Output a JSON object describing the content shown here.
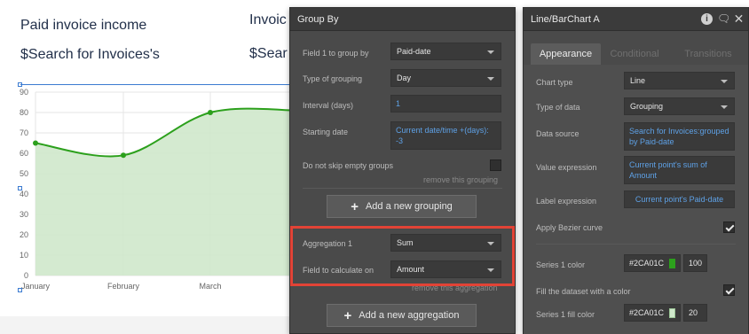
{
  "canvas": {
    "title_left": "Paid invoice income",
    "subtitle_left": "$Search for Invoices's",
    "title_right_partial": "Invoic",
    "subtitle_right_partial": "$Sear"
  },
  "chart_data": {
    "type": "area",
    "x": [
      "January",
      "February",
      "March"
    ],
    "series": [
      {
        "values": [
          65,
          59,
          80,
          81
        ]
      }
    ],
    "x_positions_labels": [
      "January",
      "February",
      "March"
    ],
    "ylim": [
      0,
      90
    ],
    "y_ticks": [
      "90",
      "80",
      "70",
      "60",
      "50",
      "40",
      "30",
      "20",
      "10",
      "0"
    ],
    "line_color": "#2CA01C",
    "fill_color": "#cfe8cb",
    "grid": true,
    "bezier": true
  },
  "group_by": {
    "title": "Group By",
    "field1_label": "Field 1 to group by",
    "field1_value": "Paid-date",
    "type_label": "Type of grouping",
    "type_value": "Day",
    "interval_label": "Interval (days)",
    "interval_value": "1",
    "start_label": "Starting date",
    "start_value": "Current date/time +(days): -3",
    "skip_label": "Do not skip empty groups",
    "remove_grouping": "remove this grouping",
    "add_grouping": "Add a new grouping",
    "agg_label": "Aggregation 1",
    "agg_value": "Sum",
    "calc_label": "Field to calculate on",
    "calc_value": "Amount",
    "remove_agg": "remove this aggregation",
    "add_agg": "Add a new aggregation"
  },
  "chart_panel": {
    "title": "Line/BarChart A",
    "tabs": [
      "Appearance",
      "Conditional",
      "Transitions"
    ],
    "chart_type_label": "Chart type",
    "chart_type_value": "Line",
    "data_type_label": "Type of data",
    "data_type_value": "Grouping",
    "source_label": "Data source",
    "source_value": "Search for Invoices:grouped by Paid-date",
    "value_label": "Value expression",
    "value_value": "Current point's sum of Amount",
    "label_label": "Label expression",
    "label_value": "Current point's Paid-date",
    "bezier_label": "Apply Bezier curve",
    "s1color_label": "Series 1 color",
    "s1color_hex": "#2CA01C",
    "s1color_opacity": "100",
    "fill_label": "Fill the dataset with a color",
    "s1fill_label": "Series 1 fill color",
    "s1fill_hex": "#2CA01C",
    "s1fill_opacity": "20"
  },
  "colors": {
    "accent_red": "#e24336",
    "link_blue": "#5ea1e6",
    "panel_bg": "#4a4a4a"
  }
}
